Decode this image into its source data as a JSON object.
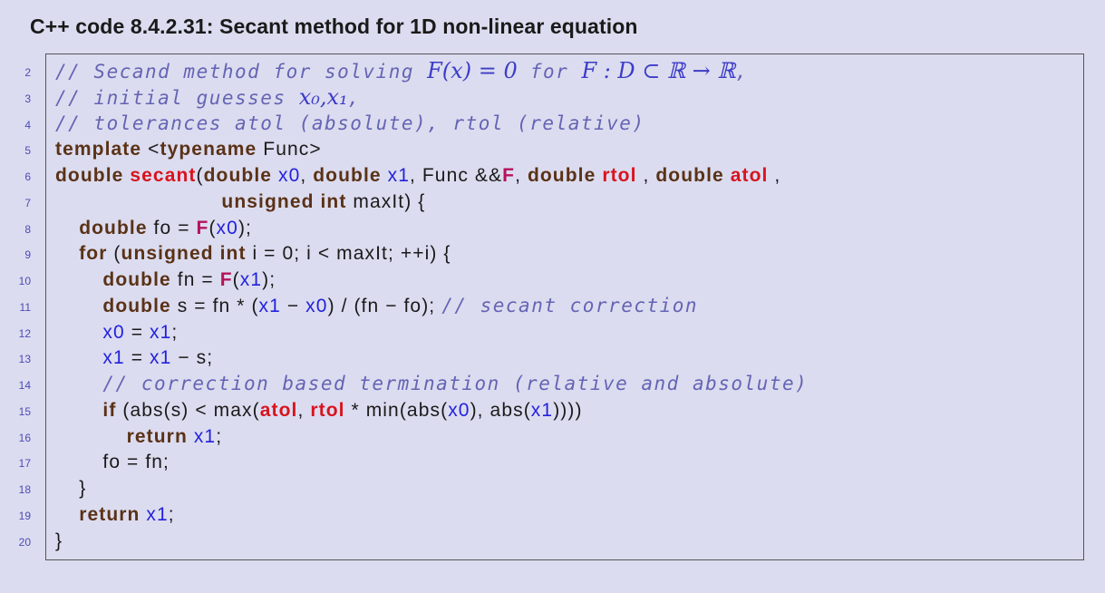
{
  "title": "C++ code 8.4.2.31: Secant method for 1D non-linear equation",
  "lines": [
    {
      "num": "2",
      "indent": 0,
      "tokens": [
        {
          "c": "comment",
          "t": "// Secand method for solving "
        },
        {
          "c": "math",
          "t": "F(x) = 0"
        },
        {
          "c": "comment",
          "t": " for "
        },
        {
          "c": "math",
          "t": "F : D ⊂ ℝ → ℝ"
        },
        {
          "c": "comment",
          "t": ","
        }
      ]
    },
    {
      "num": "3",
      "indent": 0,
      "tokens": [
        {
          "c": "comment",
          "t": "// initial guesses "
        },
        {
          "c": "math",
          "t": "x₀,x₁"
        },
        {
          "c": "comment",
          "t": ","
        }
      ]
    },
    {
      "num": "4",
      "indent": 0,
      "tokens": [
        {
          "c": "comment",
          "t": "// tolerances atol (absolute), rtol (relative)"
        }
      ]
    },
    {
      "num": "5",
      "indent": 0,
      "tokens": [
        {
          "c": "kw",
          "t": "template"
        },
        {
          "c": "plain",
          "t": " <"
        },
        {
          "c": "kw",
          "t": "typename"
        },
        {
          "c": "plain",
          "t": " Func>"
        }
      ]
    },
    {
      "num": "6",
      "indent": 0,
      "tokens": [
        {
          "c": "kw",
          "t": "double"
        },
        {
          "c": "plain",
          "t": " "
        },
        {
          "c": "red",
          "t": "secant"
        },
        {
          "c": "plain",
          "t": "("
        },
        {
          "c": "kw",
          "t": "double"
        },
        {
          "c": "plain",
          "t": " "
        },
        {
          "c": "var",
          "t": "x0"
        },
        {
          "c": "plain",
          "t": ", "
        },
        {
          "c": "kw",
          "t": "double"
        },
        {
          "c": "plain",
          "t": " "
        },
        {
          "c": "var",
          "t": "x1"
        },
        {
          "c": "plain",
          "t": ", Func &&"
        },
        {
          "c": "fn",
          "t": "F"
        },
        {
          "c": "plain",
          "t": ", "
        },
        {
          "c": "kw",
          "t": "double"
        },
        {
          "c": "plain",
          "t": " "
        },
        {
          "c": "red",
          "t": "rtol"
        },
        {
          "c": "plain",
          "t": " , "
        },
        {
          "c": "kw",
          "t": "double"
        },
        {
          "c": "plain",
          "t": " "
        },
        {
          "c": "red",
          "t": "atol"
        },
        {
          "c": "plain",
          "t": " ,"
        }
      ]
    },
    {
      "num": "7",
      "indent": 7,
      "tokens": [
        {
          "c": "kw",
          "t": "unsigned int"
        },
        {
          "c": "plain",
          "t": " maxIt) {"
        }
      ]
    },
    {
      "num": "8",
      "indent": 1,
      "tokens": [
        {
          "c": "kw",
          "t": "double"
        },
        {
          "c": "plain",
          "t": " fo = "
        },
        {
          "c": "fn",
          "t": "F"
        },
        {
          "c": "plain",
          "t": "("
        },
        {
          "c": "var",
          "t": "x0"
        },
        {
          "c": "plain",
          "t": ");"
        }
      ]
    },
    {
      "num": "9",
      "indent": 1,
      "tokens": [
        {
          "c": "kw",
          "t": "for"
        },
        {
          "c": "plain",
          "t": " ("
        },
        {
          "c": "kw",
          "t": "unsigned int"
        },
        {
          "c": "plain",
          "t": " i = 0; i < maxIt; ++i) {"
        }
      ]
    },
    {
      "num": "10",
      "indent": 2,
      "tokens": [
        {
          "c": "kw",
          "t": "double"
        },
        {
          "c": "plain",
          "t": " fn = "
        },
        {
          "c": "fn",
          "t": "F"
        },
        {
          "c": "plain",
          "t": "("
        },
        {
          "c": "var",
          "t": "x1"
        },
        {
          "c": "plain",
          "t": ");"
        }
      ]
    },
    {
      "num": "11",
      "indent": 2,
      "tokens": [
        {
          "c": "kw",
          "t": "double"
        },
        {
          "c": "plain",
          "t": " s = fn * ("
        },
        {
          "c": "var",
          "t": "x1"
        },
        {
          "c": "plain",
          "t": " − "
        },
        {
          "c": "var",
          "t": "x0"
        },
        {
          "c": "plain",
          "t": ") / (fn − fo); "
        },
        {
          "c": "comment",
          "t": "// secant correction"
        }
      ]
    },
    {
      "num": "12",
      "indent": 2,
      "tokens": [
        {
          "c": "var",
          "t": "x0"
        },
        {
          "c": "plain",
          "t": " = "
        },
        {
          "c": "var",
          "t": "x1"
        },
        {
          "c": "plain",
          "t": ";"
        }
      ]
    },
    {
      "num": "13",
      "indent": 2,
      "tokens": [
        {
          "c": "var",
          "t": "x1"
        },
        {
          "c": "plain",
          "t": " = "
        },
        {
          "c": "var",
          "t": "x1"
        },
        {
          "c": "plain",
          "t": " − s;"
        }
      ]
    },
    {
      "num": "14",
      "indent": 2,
      "tokens": [
        {
          "c": "comment",
          "t": "// correction based termination (relative and absolute)"
        }
      ]
    },
    {
      "num": "15",
      "indent": 2,
      "tokens": [
        {
          "c": "kw",
          "t": "if"
        },
        {
          "c": "plain",
          "t": " (abs(s) < max("
        },
        {
          "c": "red",
          "t": "atol"
        },
        {
          "c": "plain",
          "t": ", "
        },
        {
          "c": "red",
          "t": "rtol"
        },
        {
          "c": "plain",
          "t": " * min(abs("
        },
        {
          "c": "var",
          "t": "x0"
        },
        {
          "c": "plain",
          "t": "), abs("
        },
        {
          "c": "var",
          "t": "x1"
        },
        {
          "c": "plain",
          "t": "))))"
        }
      ]
    },
    {
      "num": "16",
      "indent": 3,
      "tokens": [
        {
          "c": "kw",
          "t": "return"
        },
        {
          "c": "plain",
          "t": " "
        },
        {
          "c": "var",
          "t": "x1"
        },
        {
          "c": "plain",
          "t": ";"
        }
      ]
    },
    {
      "num": "17",
      "indent": 2,
      "tokens": [
        {
          "c": "plain",
          "t": "fo = fn;"
        }
      ]
    },
    {
      "num": "18",
      "indent": 1,
      "tokens": [
        {
          "c": "plain",
          "t": "}"
        }
      ]
    },
    {
      "num": "19",
      "indent": 1,
      "tokens": [
        {
          "c": "kw",
          "t": "return"
        },
        {
          "c": "plain",
          "t": " "
        },
        {
          "c": "var",
          "t": "x1"
        },
        {
          "c": "plain",
          "t": ";"
        }
      ]
    },
    {
      "num": "20",
      "indent": 0,
      "tokens": [
        {
          "c": "plain",
          "t": "}"
        }
      ]
    }
  ]
}
